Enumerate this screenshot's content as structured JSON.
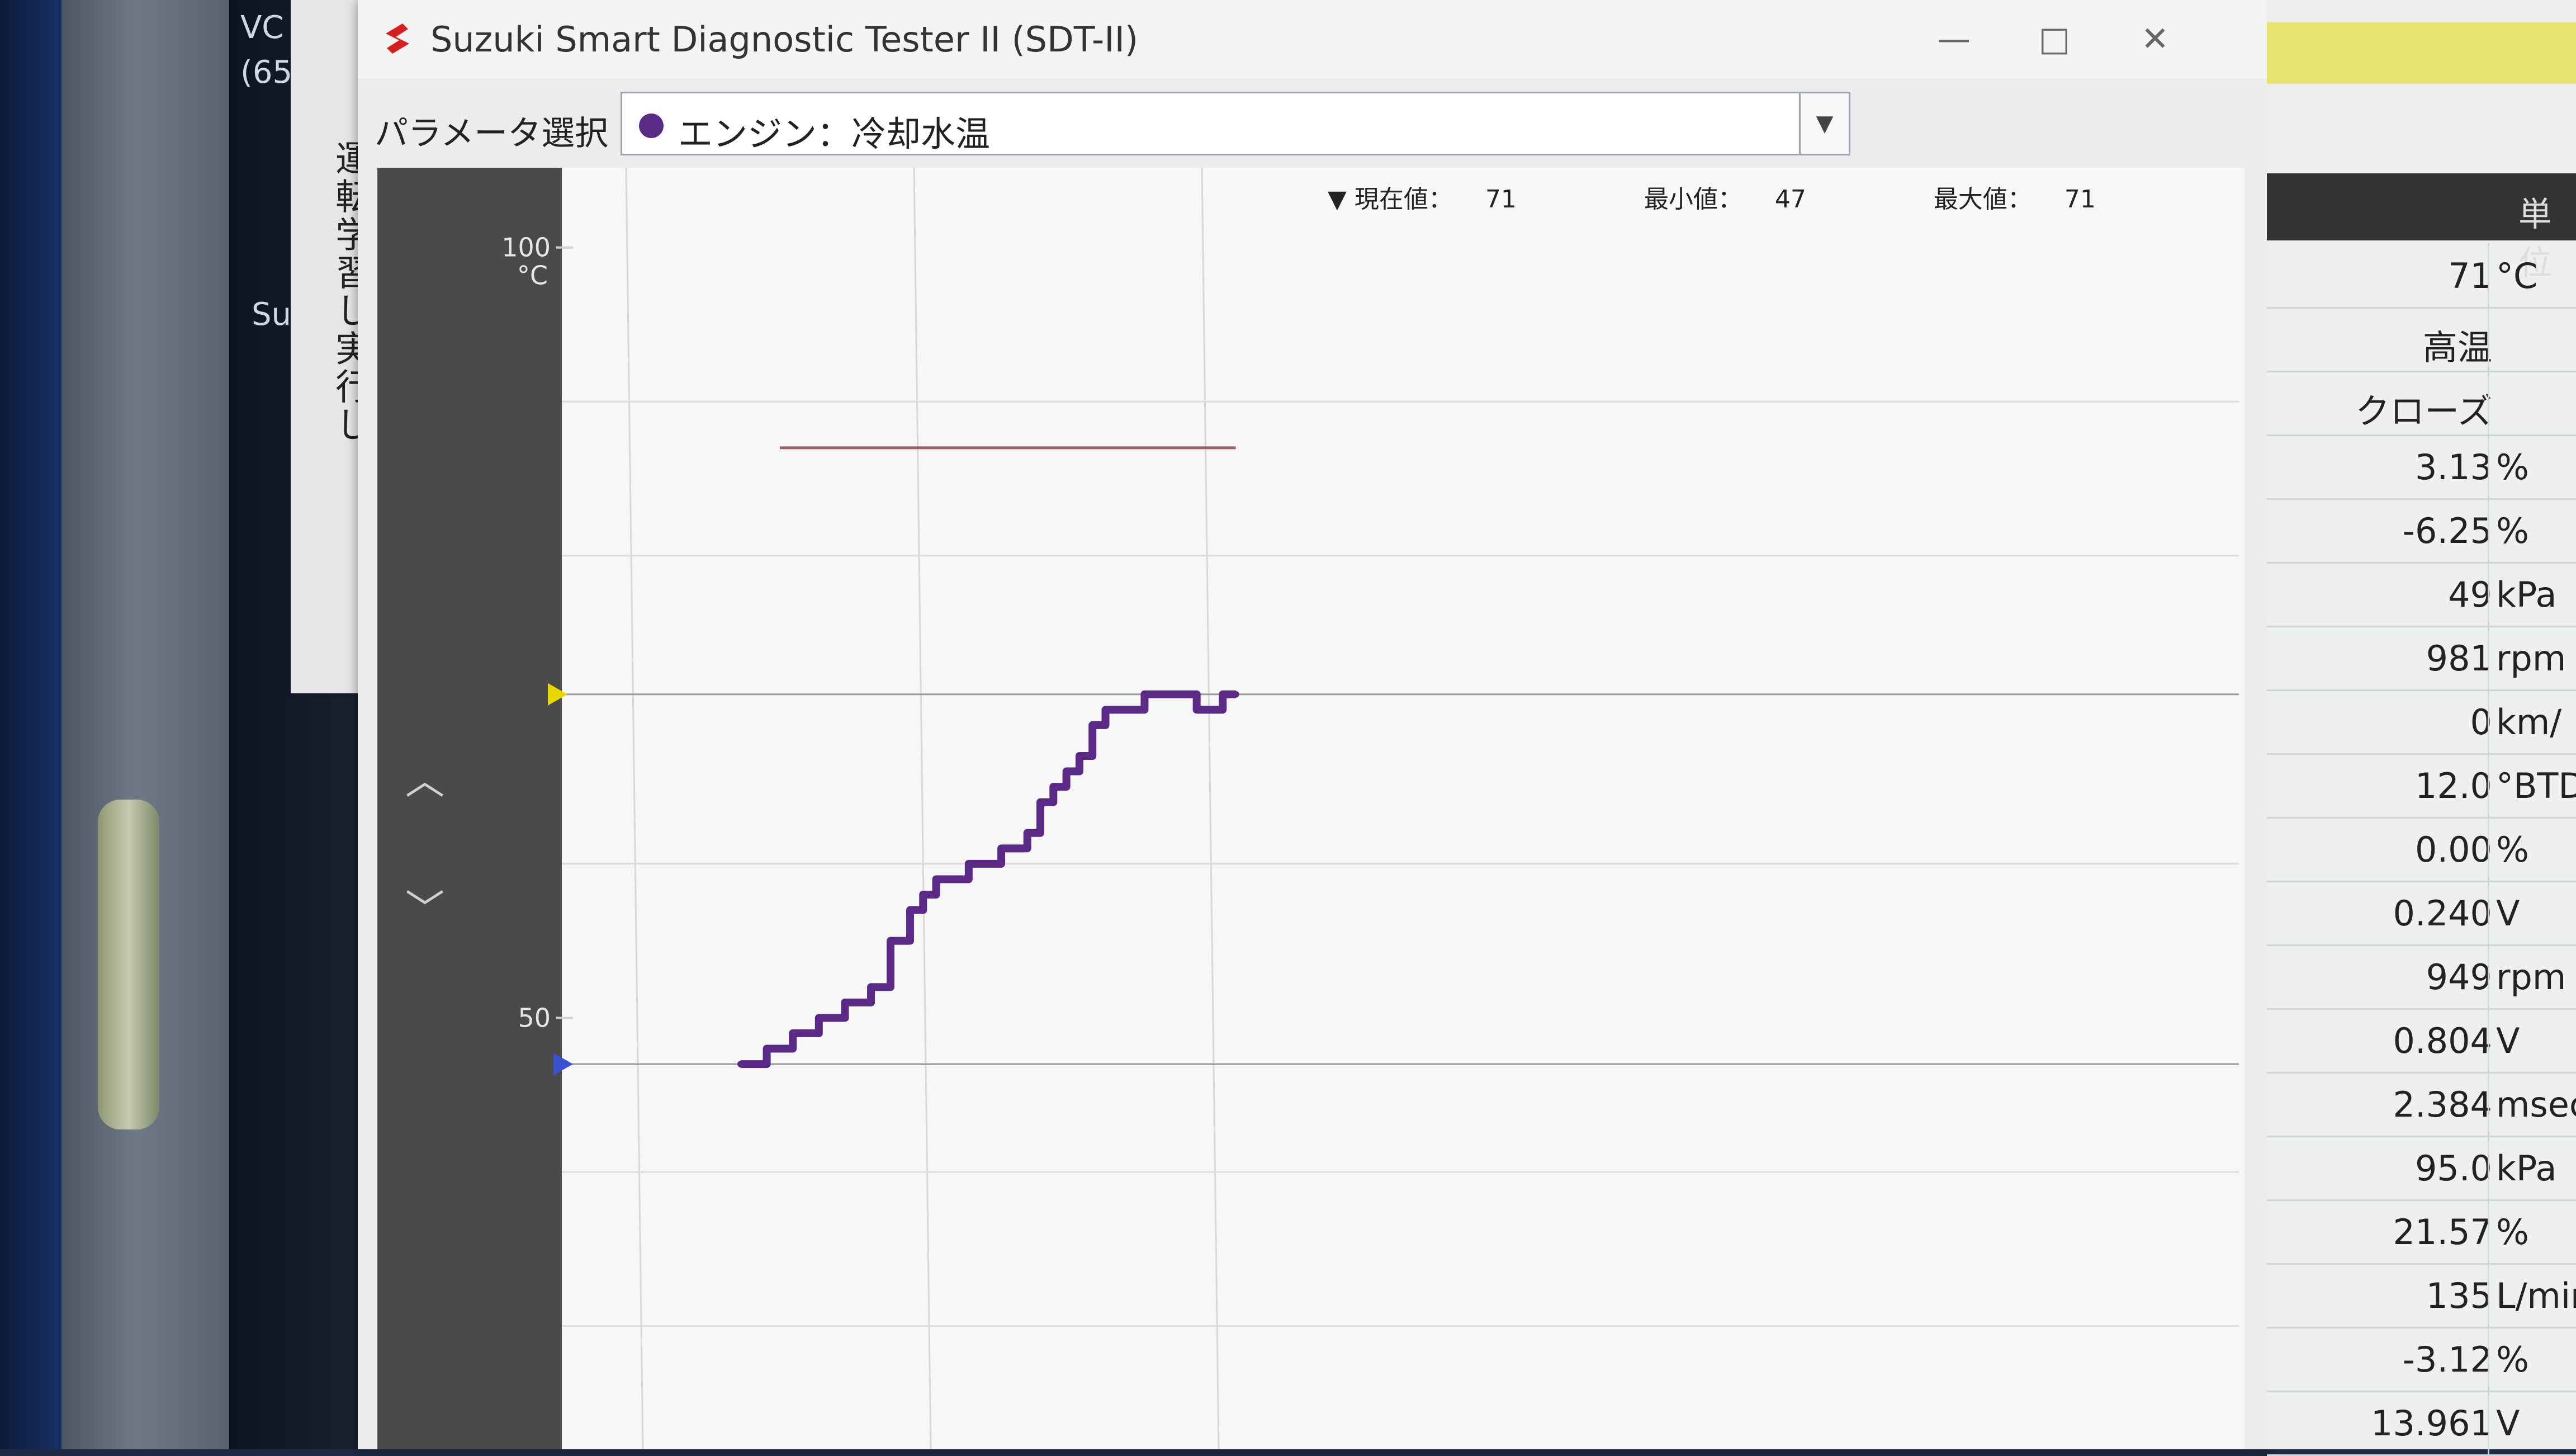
{
  "desktop": {
    "text_lines": [
      "VC",
      "(65"
    ],
    "text_su": "Su"
  },
  "background_dialog": {
    "vertical_text": "運転学習し実行し"
  },
  "window": {
    "title": "Suzuki Smart Diagnostic Tester II (SDT-II)",
    "buttons": {
      "minimize": "—",
      "maximize": "□",
      "close": "✕"
    }
  },
  "parameter": {
    "label": "パラメータ選択",
    "selected": "エンジン：冷却水温",
    "dot_color": "#5b2a86"
  },
  "stats": {
    "current_label": "▼ 現在値：",
    "current_value": "71",
    "min_label": "最小値：",
    "min_value": "47",
    "max_label": "最大値：",
    "max_value": "71"
  },
  "chart_data": {
    "type": "line",
    "title": "",
    "xlabel": "",
    "ylabel": "°C",
    "ylim": [
      22,
      103
    ],
    "y_ticks": [
      {
        "value": 100,
        "label": "100"
      },
      {
        "value": 50,
        "label": "50"
      }
    ],
    "unit_label": "°C",
    "grid": true,
    "colors": {
      "series": "#5b2a86",
      "ref_line": "#a06060",
      "marker_max": "#e8d800",
      "marker_min": "#3a52d0"
    },
    "reference_line": {
      "value": 87,
      "x_start": 6,
      "x_end": 76
    },
    "max_marker": 71,
    "min_marker": 47,
    "series": [
      {
        "x": [
          0,
          4,
          8,
          12,
          16,
          20,
          23,
          26,
          28,
          30,
          32,
          35,
          40,
          44,
          46,
          48,
          50,
          52,
          54,
          56,
          58,
          60,
          62,
          64,
          66,
          68,
          70,
          72,
          74,
          76
        ],
        "values": [
          47,
          48,
          49,
          50,
          51,
          52,
          55,
          57,
          58,
          59,
          59,
          60,
          61,
          62,
          64,
          65,
          66,
          67,
          69,
          70,
          70,
          70,
          71,
          71,
          71,
          71,
          70,
          70,
          71,
          71
        ]
      }
    ]
  },
  "table": {
    "header": "単位",
    "rows": [
      {
        "value": "71",
        "unit": "°C"
      },
      {
        "value": "高温",
        "unit": ""
      },
      {
        "value": "クローズ",
        "unit": ""
      },
      {
        "value": "3.13",
        "unit": "%"
      },
      {
        "value": "-6.25",
        "unit": "%"
      },
      {
        "value": "49",
        "unit": "kPa"
      },
      {
        "value": "981",
        "unit": "rpm"
      },
      {
        "value": "0",
        "unit": "km/"
      },
      {
        "value": "12.0",
        "unit": "°BTD"
      },
      {
        "value": "0.00",
        "unit": "%"
      },
      {
        "value": "0.240",
        "unit": "V"
      },
      {
        "value": "949",
        "unit": "rpm"
      },
      {
        "value": "0.804",
        "unit": "V"
      },
      {
        "value": "2.384",
        "unit": "msec"
      },
      {
        "value": "95.0",
        "unit": "kPa"
      },
      {
        "value": "21.57",
        "unit": "%"
      },
      {
        "value": "135",
        "unit": "L/min"
      },
      {
        "value": "-3.12",
        "unit": "%"
      },
      {
        "value": "13.961",
        "unit": "V"
      }
    ]
  }
}
